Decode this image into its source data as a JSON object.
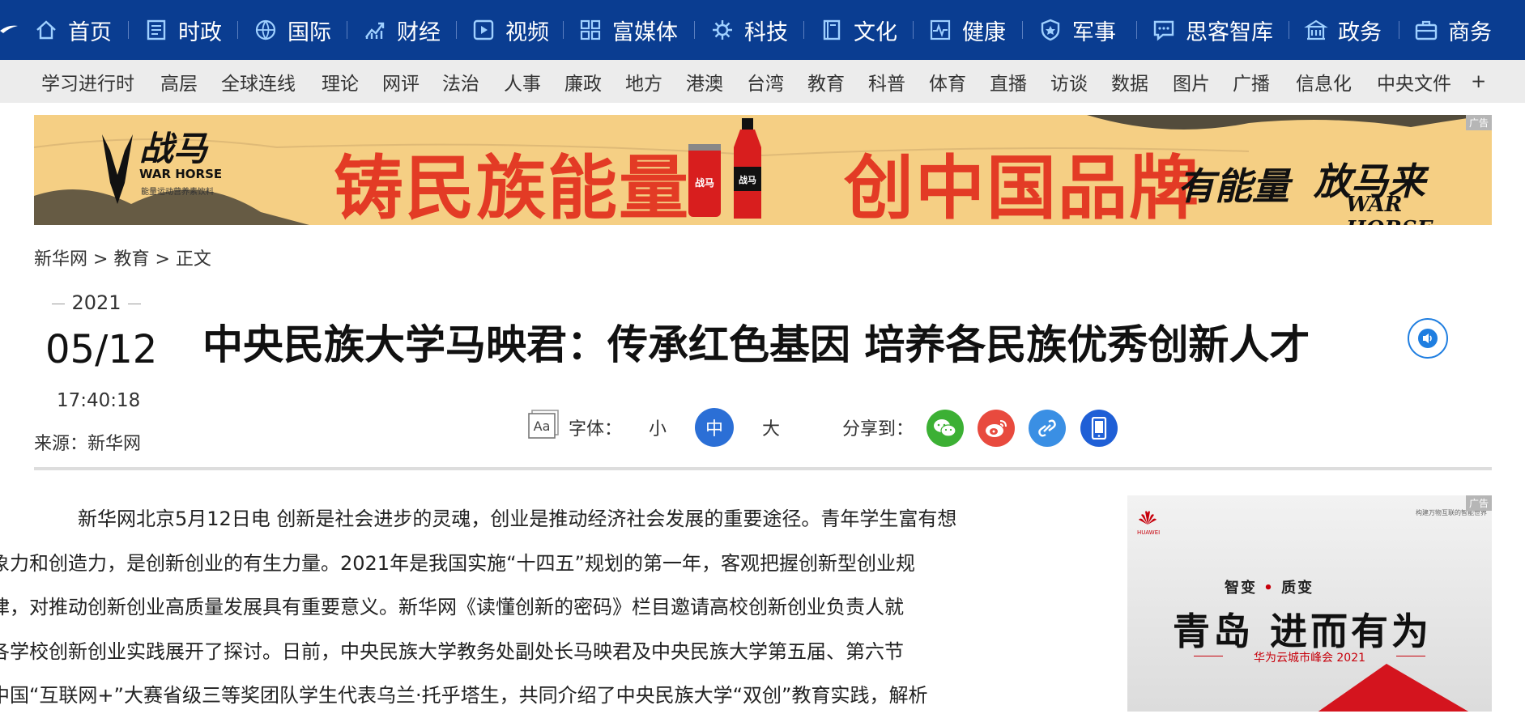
{
  "topnav": {
    "items": [
      {
        "label": "首页",
        "icon": "home-icon"
      },
      {
        "label": "时政",
        "icon": "document-icon"
      },
      {
        "label": "国际",
        "icon": "globe-icon"
      },
      {
        "label": "财经",
        "icon": "chart-icon"
      },
      {
        "label": "视频",
        "icon": "play-icon"
      },
      {
        "label": "富媒体",
        "icon": "grid-icon"
      },
      {
        "label": "科技",
        "icon": "gear-icon"
      },
      {
        "label": "文化",
        "icon": "book-icon"
      },
      {
        "label": "健康",
        "icon": "heartbeat-icon"
      },
      {
        "label": "军事",
        "icon": "shield-icon"
      },
      {
        "label": "思客智库",
        "icon": "chat-icon"
      },
      {
        "label": "政务",
        "icon": "building-icon"
      },
      {
        "label": "商务",
        "icon": "briefcase-icon"
      }
    ]
  },
  "subnav": {
    "items": [
      "学习进行时",
      "高层",
      "全球连线",
      "理论",
      "网评",
      "法治",
      "人事",
      "廉政",
      "地方",
      "港澳",
      "台湾",
      "教育",
      "科普",
      "体育",
      "直播",
      "访谈",
      "数据",
      "图片",
      "广播",
      "信息化",
      "中央文件",
      "+"
    ]
  },
  "banner": {
    "ad_label": "广告",
    "brand_cn": "战马",
    "brand_en": "WAR HORSE",
    "brand_sub": "能量运动营养素饮料",
    "slogan_left": "铸民族能量",
    "slogan_right": "创中国品牌",
    "tagline_1": "有能量",
    "tagline_2": "放马来",
    "tagline_en": "WAR HORSE",
    "colors": {
      "background": "#f5cf84",
      "slogan": "#e33b25"
    }
  },
  "breadcrumb": {
    "site": "新华网",
    "sep1": " > ",
    "section": "教育",
    "sep2": " > ",
    "current": "正文"
  },
  "article_meta": {
    "year": "2021",
    "date": "05/12",
    "time": "17:40:18",
    "source": "来源：新华网"
  },
  "title": "中央民族大学马映君：传承红色基因 培养各民族优秀创新人才",
  "tools": {
    "font_label": "字体：",
    "font_small": "小",
    "font_medium": "中",
    "font_large": "大",
    "share_label": "分享到："
  },
  "share_icons": [
    "wechat-icon",
    "weibo-icon",
    "link-icon",
    "mobile-icon"
  ],
  "article": {
    "line1": "新华网北京5月12日电 创新是社会进步的灵魂，创业是推动经济社会发展的重要途径。青年学生富有想",
    "line2": "象力和创造力，是创新创业的有生力量。2021年是我国实施“十四五”规划的第一年，客观把握创新型创业规",
    "line3": "律，对推动创新创业高质量发展具有重要意义。新华网《读懂创新的密码》栏目邀请高校创新创业负责人就",
    "line4": "各学校创新创业实践展开了探讨。日前，中央民族大学教务处副处长马映君及中央民族大学第五届、第六节",
    "line5": "中国“互联网+”大赛省级三等奖团队学生代表乌兰·托乎塔生，共同介绍了中央民族大学“双创”教育实践，解析"
  },
  "side_ad": {
    "ad_label": "广告",
    "brand": "HUAWEI",
    "top_right": "构建万物互联的智能世界",
    "line1a": "智变",
    "line1dot": "•",
    "line1b": "质变",
    "line2": "青岛 进而有为",
    "line3": "华为云城市峰会 2021"
  },
  "colors": {
    "nav_bg": "#0a3d91",
    "subnav_bg": "#ececec",
    "accent": "#2b6fd6"
  }
}
